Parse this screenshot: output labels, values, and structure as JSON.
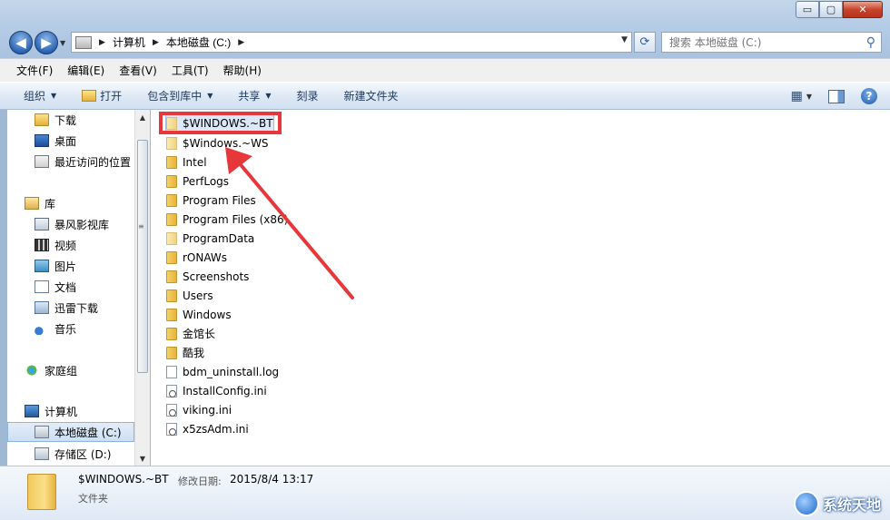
{
  "window": {
    "minimize": "▭",
    "maximize": "▢",
    "close": "✕"
  },
  "nav": {
    "back": "◀",
    "forward": "▶"
  },
  "address": {
    "crumbs": [
      "计算机",
      "本地磁盘 (C:)"
    ]
  },
  "search": {
    "placeholder": "搜索 本地磁盘 (C:)"
  },
  "menu": [
    "文件(F)",
    "编辑(E)",
    "查看(V)",
    "工具(T)",
    "帮助(H)"
  ],
  "toolbar": {
    "organize": "组织",
    "open": "打开",
    "include_library": "包含到库中",
    "share": "共享",
    "burn": "刻录",
    "new_folder": "新建文件夹"
  },
  "sidebar": {
    "items": [
      {
        "label": "下载",
        "icon": "downloads-folder-icon"
      },
      {
        "label": "桌面",
        "icon": "desktop-icon"
      },
      {
        "label": "最近访问的位置",
        "icon": "recent-places-icon"
      },
      {
        "label": "库",
        "icon": "libraries-icon"
      },
      {
        "label": "暴风影视库",
        "icon": "video-library-icon"
      },
      {
        "label": "视频",
        "icon": "videos-icon"
      },
      {
        "label": "图片",
        "icon": "pictures-icon"
      },
      {
        "label": "文档",
        "icon": "documents-icon"
      },
      {
        "label": "迅雷下载",
        "icon": "xunlei-download-icon"
      },
      {
        "label": "音乐",
        "icon": "music-icon"
      },
      {
        "label": "家庭组",
        "icon": "homegroup-icon"
      },
      {
        "label": "计算机",
        "icon": "computer-icon"
      },
      {
        "label": "本地磁盘 (C:)",
        "icon": "local-disk-icon"
      },
      {
        "label": "存储区 (D:)",
        "icon": "storage-drive-icon"
      }
    ]
  },
  "files": [
    {
      "name": "$WINDOWS.~BT",
      "type": "folder-pale"
    },
    {
      "name": "$Windows.~WS",
      "type": "folder-pale"
    },
    {
      "name": "Intel",
      "type": "folder"
    },
    {
      "name": "PerfLogs",
      "type": "folder"
    },
    {
      "name": "Program Files",
      "type": "folder"
    },
    {
      "name": "Program Files (x86)",
      "type": "folder"
    },
    {
      "name": "ProgramData",
      "type": "folder-pale"
    },
    {
      "name": "rONAWs",
      "type": "folder"
    },
    {
      "name": "Screenshots",
      "type": "folder"
    },
    {
      "name": "Users",
      "type": "folder"
    },
    {
      "name": "Windows",
      "type": "folder"
    },
    {
      "name": "金馆长",
      "type": "folder"
    },
    {
      "name": "酷我",
      "type": "folder"
    },
    {
      "name": "bdm_uninstall.log",
      "type": "file"
    },
    {
      "name": "InstallConfig.ini",
      "type": "ini"
    },
    {
      "name": "viking.ini",
      "type": "ini"
    },
    {
      "name": "x5zsAdm.ini",
      "type": "ini"
    }
  ],
  "details": {
    "name": "$WINDOWS.~BT",
    "modified_label": "修改日期:",
    "modified_value": "2015/8/4 13:17",
    "type": "文件夹"
  },
  "watermark": {
    "text": "系统天地"
  },
  "colors": {
    "annotation_red": "#e8373a",
    "selection": "#dbe8f7"
  }
}
